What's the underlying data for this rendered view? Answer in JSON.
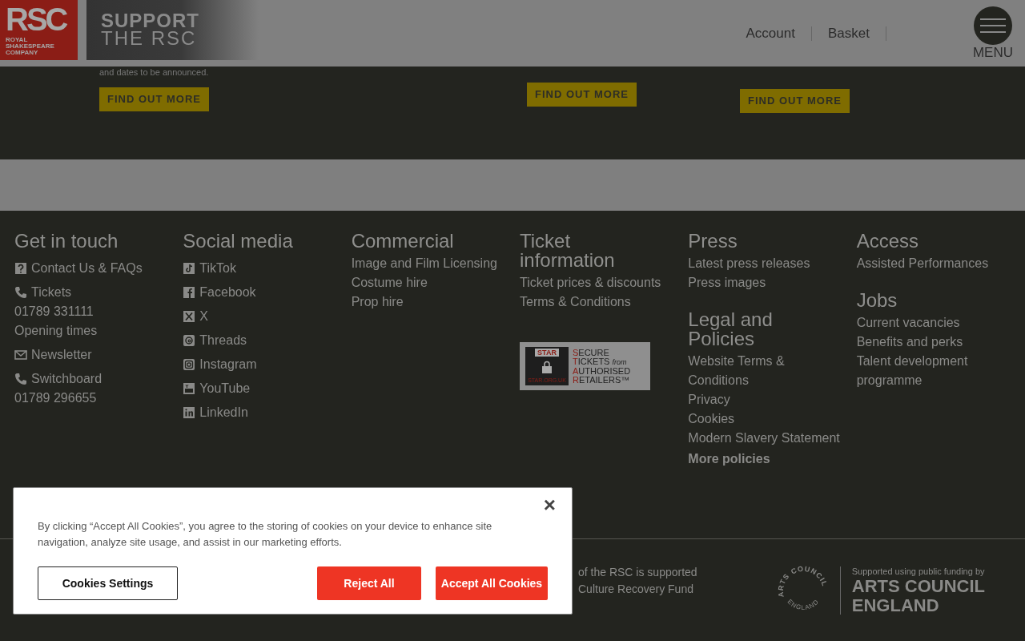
{
  "header": {
    "logo": {
      "letters": "RSC",
      "name_lines": [
        "ROYAL",
        "SHAKESPEARE",
        "COMPANY"
      ]
    },
    "promo": {
      "line_1": "SUPPORT",
      "line_2": "THE RSC"
    },
    "nav": [
      "Account",
      "Basket"
    ],
    "menu_label": "MENU"
  },
  "teasers": [
    {
      "text": "and dates to be announced.",
      "button": "FIND OUT MORE"
    },
    {
      "button": "FIND OUT MORE"
    },
    {
      "button": "FIND OUT MORE"
    }
  ],
  "footer": {
    "columns": [
      {
        "sections": [
          {
            "title": "Get in touch",
            "items": [
              {
                "kind": "question",
                "label": "Contact Us & FAQs"
              },
              {
                "kind": "phone",
                "label": "Tickets"
              },
              {
                "kind": "plain",
                "label": "01789 331111"
              },
              {
                "kind": "plain",
                "label": "Opening times"
              },
              {
                "kind": "mail",
                "label": "Newsletter"
              },
              {
                "kind": "phone",
                "label": "Switchboard"
              },
              {
                "kind": "plain",
                "label": "01789 296655"
              }
            ]
          }
        ]
      },
      {
        "sections": [
          {
            "title": "Social media",
            "items": [
              {
                "kind": "tiktok",
                "label": "TikTok"
              },
              {
                "kind": "facebook",
                "label": "Facebook"
              },
              {
                "kind": "x",
                "label": "X"
              },
              {
                "kind": "threads",
                "label": "Threads"
              },
              {
                "kind": "instagram",
                "label": "Instagram"
              },
              {
                "kind": "youtube",
                "label": "YouTube"
              },
              {
                "kind": "linkedin",
                "label": "LinkedIn"
              }
            ]
          }
        ]
      },
      {
        "sections": [
          {
            "title": "Commercial",
            "items": [
              {
                "kind": "plain",
                "label": "Image and Film Licensing"
              },
              {
                "kind": "plain",
                "label": "Costume hire"
              },
              {
                "kind": "plain",
                "label": "Prop hire"
              }
            ]
          }
        ]
      },
      {
        "sections": [
          {
            "title": "Ticket information",
            "items": [
              {
                "kind": "plain",
                "label": "Ticket prices & discounts"
              },
              {
                "kind": "plain",
                "label": "Terms & Conditions"
              },
              {
                "kind": "badge",
                "mark": "STAR",
                "site": "STAR.ORG.UK",
                "lines": [
                  "SECURE",
                  "TICKETS",
                  "from",
                  "AUTHORISED",
                  "RETAILERS™"
                ]
              }
            ]
          }
        ]
      },
      {
        "sections": [
          {
            "title": "Press",
            "items": [
              {
                "kind": "plain",
                "label": "Latest press releases"
              },
              {
                "kind": "plain",
                "label": "Press images"
              }
            ]
          },
          {
            "title": "Legal and Policies",
            "items": [
              {
                "kind": "plain",
                "label": "Website Terms & Conditions"
              },
              {
                "kind": "plain",
                "label": "Privacy"
              },
              {
                "kind": "plain",
                "label": "Cookies"
              },
              {
                "kind": "plain",
                "label": "Modern Slavery Statement"
              },
              {
                "kind": "bold",
                "label": "More policies"
              }
            ]
          }
        ]
      },
      {
        "sections": [
          {
            "title": "Access",
            "items": [
              {
                "kind": "plain",
                "label": "Assisted Performances"
              }
            ]
          },
          {
            "title": "Jobs",
            "items": [
              {
                "kind": "plain",
                "label": "Current vacancies"
              },
              {
                "kind": "plain",
                "label": "Benefits and perks"
              },
              {
                "kind": "plain",
                "label": "Talent development programme"
              }
            ]
          }
        ]
      }
    ],
    "support_text": [
      "of the RSC is supported",
      "Culture Recovery Fund"
    ],
    "funder": {
      "ring_top": "ARTS COUNCIL",
      "ring_bottom": "ENGLAND",
      "caption": "Supported using public funding by",
      "name_lines": [
        "ARTS COUNCIL",
        "ENGLAND"
      ]
    }
  },
  "cookie_banner": {
    "message": "By clicking “Accept All Cookies”, you agree to the storing of cookies on your device to enhance site navigation, analyze site usage, and assist in our marketing efforts.",
    "close": "×",
    "settings_button": "Cookies Settings",
    "reject_button": "Reject All",
    "accept_button": "Accept All Cookies"
  }
}
